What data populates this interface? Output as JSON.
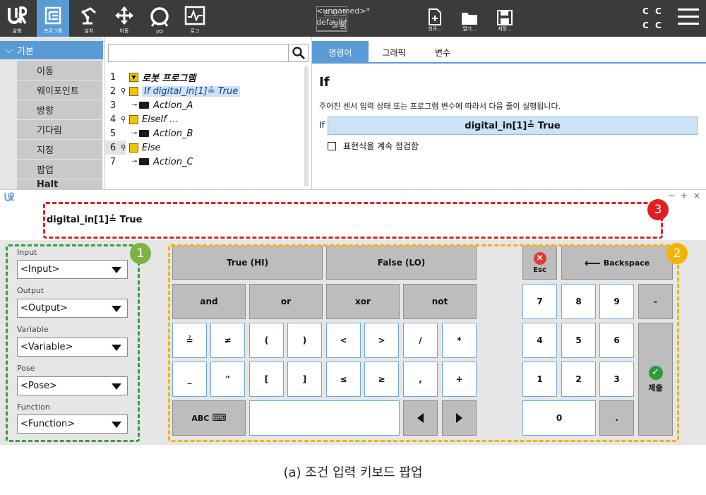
{
  "topbar": {
    "buttons": [
      {
        "label": "실행",
        "icon": "ur-logo-icon"
      },
      {
        "label": "프로그램",
        "icon": "program-icon",
        "active": true
      },
      {
        "label": "설치",
        "icon": "robot-arm-icon"
      },
      {
        "label": "이동",
        "icon": "move-arrows-icon"
      },
      {
        "label": "I/O",
        "icon": "io-icon"
      },
      {
        "label": "로그",
        "icon": "log-icon"
      }
    ],
    "program_key": "프로그램",
    "program_value": "<unnamed>*",
    "install_key": "설치",
    "install_value": "default*",
    "file_buttons": [
      {
        "label": "신규...",
        "icon": "new-file-icon"
      },
      {
        "label": "열기...",
        "icon": "open-folder-icon"
      },
      {
        "label": "저장...",
        "icon": "save-icon"
      }
    ],
    "cc": [
      "C",
      "C",
      "C",
      "C"
    ],
    "accent": "#5b9bd5"
  },
  "nav": {
    "header": "기본",
    "items": [
      "이동",
      "웨이포인트",
      "방향",
      "기다림",
      "지정",
      "팝업",
      "Halt"
    ]
  },
  "tree": {
    "search_placeholder": "",
    "lines": [
      {
        "num": "1",
        "text": "로봇 프로그램"
      },
      {
        "num": "2",
        "text": "If digital_in[1]≟ True"
      },
      {
        "num": "3",
        "text": "Action_A"
      },
      {
        "num": "4",
        "text": "ElseIf …"
      },
      {
        "num": "5",
        "text": "Action_B"
      },
      {
        "num": "6",
        "text": "Else"
      },
      {
        "num": "7",
        "text": "Action_C"
      }
    ]
  },
  "right": {
    "tabs": [
      "명령어",
      "그래픽",
      "변수"
    ],
    "title": "If",
    "description": "주어진 센서 입력 상태 또는 프로그램 변수에 따라서 다음 줄이 실행됩니다.",
    "if_label": "If",
    "if_value": "digital_in[1]≟ True",
    "checkbox_label": "표현식을 계속 점검함"
  },
  "popup": {
    "window_controls": [
      "−",
      "+",
      "×"
    ],
    "expression": "digital_in[1]≟ True",
    "badges": [
      "1",
      "2",
      "3"
    ],
    "selectors": [
      {
        "label": "Input",
        "value": "<Input>"
      },
      {
        "label": "Output",
        "value": "<Output>"
      },
      {
        "label": "Variable",
        "value": "<Variable>"
      },
      {
        "label": "Pose",
        "value": "<Pose>"
      },
      {
        "label": "Function",
        "value": "<Function>"
      }
    ],
    "keys": {
      "true": "True (HI)",
      "false": "False (LO)",
      "and": "and",
      "or": "or",
      "xor": "xor",
      "not": "not",
      "row3": [
        "≟",
        "≠",
        "(",
        ")",
        "<",
        ">",
        "/",
        "*"
      ],
      "row4": [
        "_",
        "\"",
        "[",
        "]",
        "≤",
        "≥",
        ",",
        "+"
      ],
      "abc": "ABC",
      "esc": "Esc",
      "backspace": "Backspace",
      "numpad": [
        "7",
        "8",
        "9",
        "-",
        "4",
        "5",
        "6",
        "1",
        "2",
        "3",
        "0",
        "."
      ],
      "submit": "제출"
    }
  },
  "caption": "(a) 조건 입력 키보드 팝업"
}
